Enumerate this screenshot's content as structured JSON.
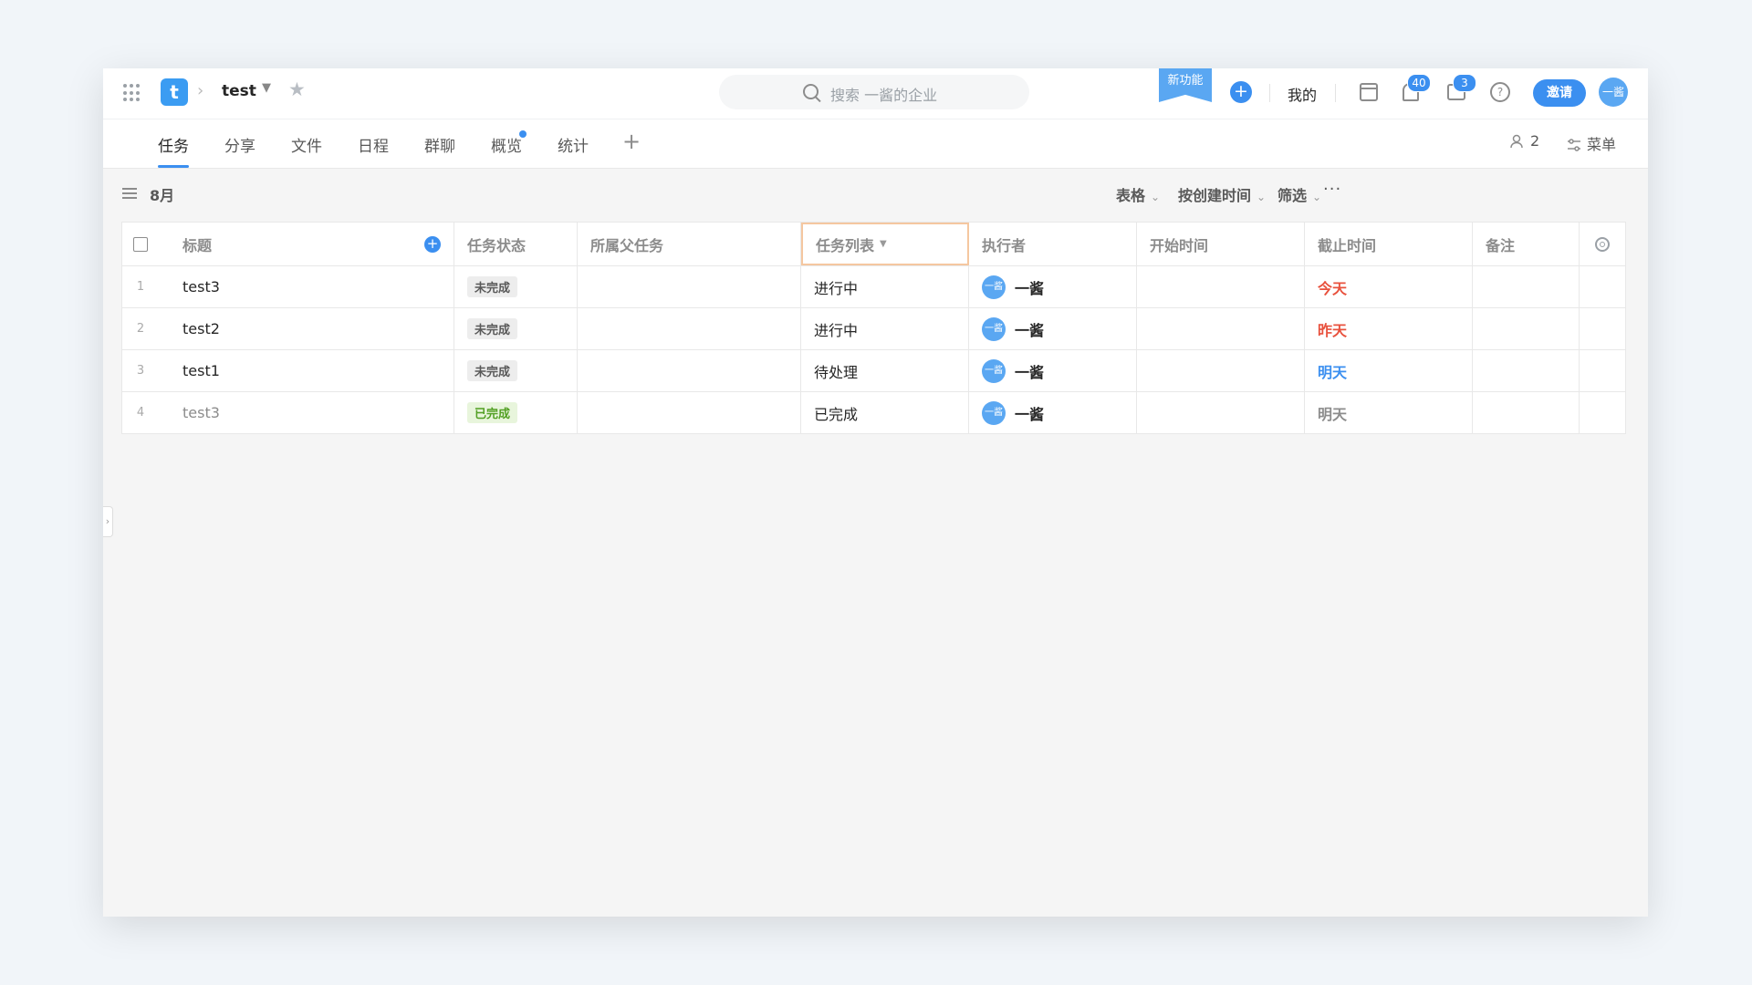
{
  "header": {
    "project_logo": "t",
    "project_name": "test",
    "search_placeholder": "搜索 一酱的企业",
    "new_feature_label": "新功能",
    "mine_label": "我的",
    "notifications_count": "40",
    "messages_count": "3",
    "help_glyph": "?",
    "invite_label": "邀请",
    "avatar_text": "一酱"
  },
  "tabs": [
    {
      "label": "任务",
      "active": true
    },
    {
      "label": "分享"
    },
    {
      "label": "文件"
    },
    {
      "label": "日程"
    },
    {
      "label": "群聊"
    },
    {
      "label": "概览",
      "dot": true
    },
    {
      "label": "统计"
    }
  ],
  "tab_actions": {
    "members_count": "2",
    "menu_label": "菜单"
  },
  "toolbar": {
    "month": "8月",
    "view_label": "表格",
    "sort_label": "按创建时间",
    "filter_label": "筛选",
    "more_glyph": "···"
  },
  "table": {
    "columns": [
      "标题",
      "任务状态",
      "所属父任务",
      "任务列表",
      "执行者",
      "开始时间",
      "截止时间",
      "备注"
    ],
    "rows": [
      {
        "num": "1",
        "title": "test3",
        "status": "未完成",
        "parent": "",
        "list": "进行中",
        "exec_avatar": "一酱",
        "exec": "一酱",
        "start": "",
        "due": "今天",
        "due_color": "#e8513d",
        "note": ""
      },
      {
        "num": "2",
        "title": "test2",
        "status": "未完成",
        "parent": "",
        "list": "进行中",
        "exec_avatar": "一酱",
        "exec": "一酱",
        "start": "",
        "due": "昨天",
        "due_color": "#e8513d",
        "note": ""
      },
      {
        "num": "3",
        "title": "test1",
        "status": "未完成",
        "parent": "",
        "list": "待处理",
        "exec_avatar": "一酱",
        "exec": "一酱",
        "start": "",
        "due": "明天",
        "due_color": "#3b8ff0",
        "note": ""
      },
      {
        "num": "4",
        "title": "test3",
        "status": "已完成",
        "parent": "",
        "list": "已完成",
        "exec_avatar": "一酱",
        "exec": "一酱",
        "start": "",
        "due": "明天",
        "due_color": "#8c8c8c",
        "note": ""
      }
    ]
  },
  "colors": {
    "accent": "#3b8ff0",
    "done_tag_bg": "#e8f5dc",
    "done_tag_text": "#52a024"
  }
}
